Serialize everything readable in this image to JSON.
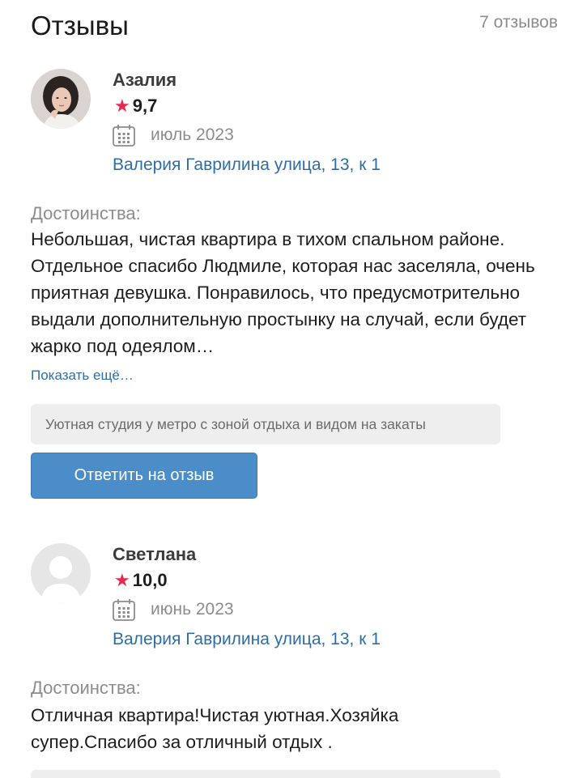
{
  "header": {
    "title": "Отзывы",
    "count": "7 отзывов"
  },
  "reviews": [
    {
      "name": "Азалия",
      "rating": "9,7",
      "date": "июль 2023",
      "address": "Валерия Гаврилина улица, 13, к 1",
      "section_label": "Достоинства:",
      "text": "Небольшая, чистая квартира в тихом спальном районе. Отдельное спасибо Людмиле, которая нас заселяла, очень приятная девушка. Понравилось, что предусмотрительно выдали дополнительную простынку на случай, если будет жарко под одеялом…",
      "show_more": "Показать ещё…",
      "listing": "Уютная студия у метро с зоной отдыха и видом на закаты",
      "reply_label": "Ответить на отзыв"
    },
    {
      "name": "Светлана",
      "rating": "10,0",
      "date": "июнь 2023",
      "address": "Валерия Гаврилина улица, 13, к 1",
      "section_label": "Достоинства:",
      "text": "Отличная квартира!Чистая уютная.Хозяйка супер.Спасибо за отличный отдых ."
    }
  ],
  "icons": {
    "star": "star-icon",
    "calendar": "calendar-icon"
  },
  "colors": {
    "accent_link": "#2e6ea6",
    "star": "#e8294f",
    "button": "#4b8dc9"
  }
}
